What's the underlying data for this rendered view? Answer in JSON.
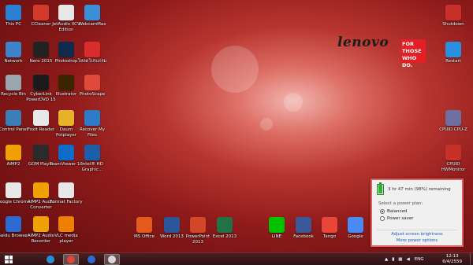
{
  "desktop": {
    "brand": {
      "logo": "lenovo",
      "tagline": "FOR THOSE WHO DO."
    },
    "icons": [
      {
        "label": "This PC",
        "icon": "computer-icon",
        "color": "#2b7fd1"
      },
      {
        "label": "CCleaner",
        "icon": "ccleaner-icon",
        "color": "#d23b2a"
      },
      {
        "label": "JetAudio XCV Edition",
        "icon": "jetaudio-icon",
        "color": "#e8e8e8"
      },
      {
        "label": "WebcamMax",
        "icon": "webcammax-icon",
        "color": "#3a8fd6"
      },
      {
        "label": "Network",
        "icon": "network-icon",
        "color": "#3f83c9"
      },
      {
        "label": "Nero 2015",
        "icon": "nero-icon",
        "color": "#222222"
      },
      {
        "label": "Photoshop",
        "icon": "photoshop-icon",
        "color": "#0f2a4a"
      },
      {
        "label": "โหลดโปรแกรม",
        "icon": "download-program-icon",
        "color": "#d92c2c"
      },
      {
        "label": "Recycle Bin",
        "icon": "recycle-bin-icon",
        "color": "#9aa5ad"
      },
      {
        "label": "CyberLink PowerDVD 15",
        "icon": "powerdvd-icon",
        "color": "#1b1b1b"
      },
      {
        "label": "Illustrator",
        "icon": "illustrator-icon",
        "color": "#3a2500"
      },
      {
        "label": "PhotoScape",
        "icon": "photoscape-icon",
        "color": "#e04a3a"
      },
      {
        "label": "Control Panel",
        "icon": "control-panel-icon",
        "color": "#3c7fb8"
      },
      {
        "label": "Foxit Reader",
        "icon": "foxit-reader-icon",
        "color": "#e8e8e8"
      },
      {
        "label": "Daum Potplayer",
        "icon": "potplayer-icon",
        "color": "#e7b22a"
      },
      {
        "label": "Recover My Files",
        "icon": "recover-files-icon",
        "color": "#2e7cc9"
      },
      {
        "label": "AIMP2",
        "icon": "aimp-icon",
        "color": "#f0a000"
      },
      {
        "label": "GOM Player",
        "icon": "gom-player-icon",
        "color": "#2b2b2b"
      },
      {
        "label": "TeamViewer 10",
        "icon": "teamviewer-icon",
        "color": "#0e6bc9"
      },
      {
        "label": "Intel® HD Graphic...",
        "icon": "intel-graphics-icon",
        "color": "#1a5fa8"
      },
      {
        "label": "Google Chrome",
        "icon": "chrome-icon",
        "color": "#e8e8e8"
      },
      {
        "label": "AIMP2 Audio Converter",
        "icon": "aimp-converter-icon",
        "color": "#f0a000"
      },
      {
        "label": "Format Factory",
        "icon": "format-factory-icon",
        "color": "#e8e8e8"
      },
      {
        "label": "Baidu Browser",
        "icon": "baidu-browser-icon",
        "color": "#2c6bd1"
      },
      {
        "label": "AIMP2 Audio Recorder",
        "icon": "aimp-recorder-icon",
        "color": "#f0a000"
      },
      {
        "label": "VLC media player",
        "icon": "vlc-icon",
        "color": "#f07f00"
      },
      {
        "label": "Shutdown",
        "icon": "shutdown-icon",
        "color": "#c8302a"
      },
      {
        "label": "Restart",
        "icon": "restart-icon",
        "color": "#2b8fe0"
      },
      {
        "label": "CPUID CPU-Z",
        "icon": "cpuz-icon",
        "color": "#6e6ea0"
      },
      {
        "label": "CPUID HWMonitor",
        "icon": "hwmonitor-icon",
        "color": "#c8302a"
      },
      {
        "label": "MS Office",
        "icon": "ms-office-icon",
        "color": "#e45a1c"
      },
      {
        "label": "Word 2013",
        "icon": "word-icon",
        "color": "#2b579a"
      },
      {
        "label": "PowerPoint 2013",
        "icon": "powerpoint-icon",
        "color": "#d24726"
      },
      {
        "label": "Excel 2013",
        "icon": "excel-icon",
        "color": "#217346"
      },
      {
        "label": "LINE",
        "icon": "line-icon",
        "color": "#00c300"
      },
      {
        "label": "Facebook",
        "icon": "facebook-icon",
        "color": "#3b5998"
      },
      {
        "label": "Tango",
        "icon": "tango-icon",
        "color": "#e8463a"
      },
      {
        "label": "Google",
        "icon": "google-icon",
        "color": "#4a8af4"
      }
    ]
  },
  "battery_popup": {
    "status": "3 hr 47 min (98%) remaining",
    "charge_percent": 98,
    "plan_title": "Select a power plan:",
    "plans": [
      {
        "label": "Balanced",
        "selected": true
      },
      {
        "label": "Power saver",
        "selected": false
      }
    ],
    "link_brightness": "Adjust screen brightness",
    "link_options": "More power options"
  },
  "taskbar": {
    "pinned": [
      {
        "icon": "internet-explorer-icon",
        "color": "#2a8fe0"
      },
      {
        "icon": "chrome-taskbar-icon",
        "color": "#e0453a",
        "active": true
      },
      {
        "icon": "baidu-taskbar-icon",
        "color": "#2c6bd1"
      },
      {
        "icon": "photoscape-taskbar-icon",
        "color": "#d8d8d8",
        "active": true
      }
    ],
    "language": "ENG",
    "time": "12:13",
    "date": "6/4/2559"
  }
}
